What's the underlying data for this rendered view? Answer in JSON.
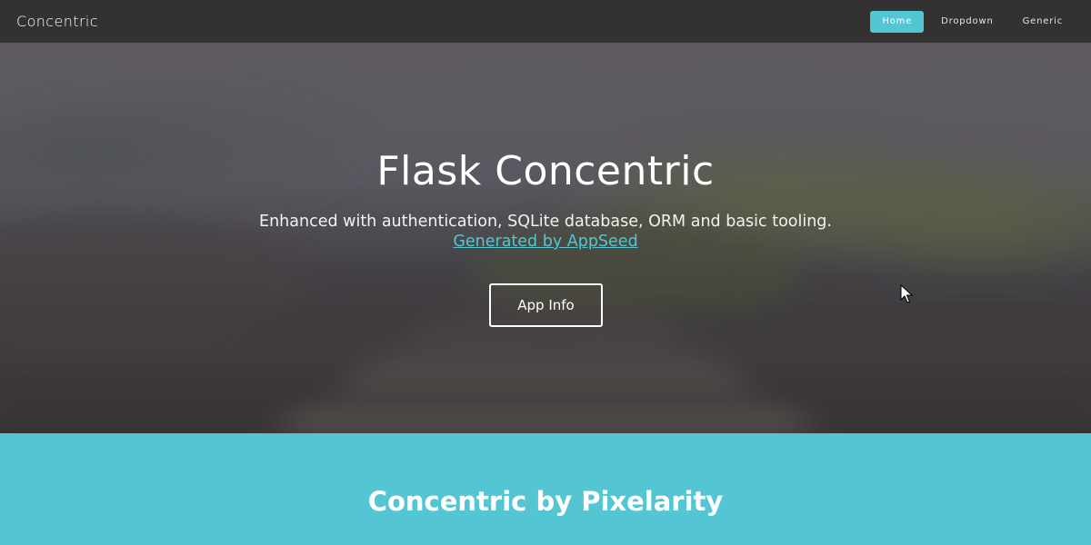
{
  "navbar": {
    "brand": "Concentric",
    "items": [
      {
        "label": "Home",
        "active": true
      },
      {
        "label": "Dropdown",
        "active": false
      },
      {
        "label": "Generic",
        "active": false
      }
    ]
  },
  "hero": {
    "title": "Flask Concentric",
    "subtitle": "Enhanced with authentication, SQLite database, ORM and basic tooling.",
    "link_text": "Generated by AppSeed",
    "button_label": "App Info"
  },
  "band": {
    "title": "Concentric by Pixelarity"
  },
  "colors": {
    "accent": "#54c5d3",
    "navbar_bg": "#333132"
  }
}
